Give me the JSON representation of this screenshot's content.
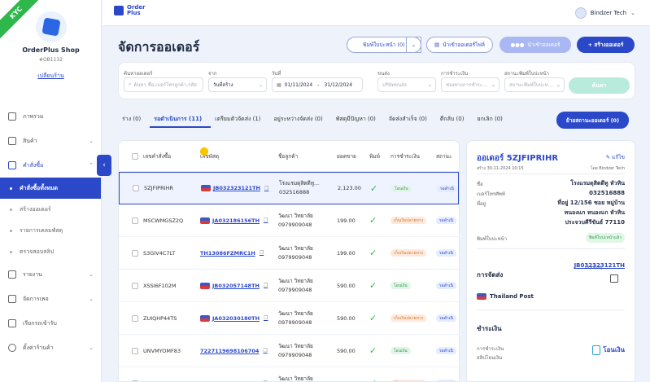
{
  "sidebar": {
    "kyc": "KYC",
    "shop_name": "OrderPlus Shop",
    "shop_id": "#OB1132",
    "change_shop": "เปลี่ยนร้าน",
    "items": [
      {
        "label": "ภาพรวม",
        "icon": "chart-icon"
      },
      {
        "label": "สินค้า",
        "icon": "box-icon"
      },
      {
        "label": "คำสั่งซื้อ",
        "icon": "cart-icon"
      },
      {
        "label": "รายงาน",
        "icon": "report-icon"
      },
      {
        "label": "จัดการเพจ",
        "icon": "chat-icon"
      },
      {
        "label": "เรียกรถเข้ารับ",
        "icon": "truck-icon"
      },
      {
        "label": "ตั้งค่าร้านค้า",
        "icon": "gear-icon"
      }
    ],
    "orders_sub": [
      "คำสั่งซื้อทั้งหมด",
      "สร้างออเดอร์",
      "รายการเคลมพัสดุ",
      "ตรวจสอบสลิป"
    ]
  },
  "topbar": {
    "logo_line1": "Order",
    "logo_line2": "Plus",
    "user_name": "Bindzer Tech"
  },
  "page": {
    "title": "จัดการออเดอร์",
    "print_label": "พิมพ์ใบปะหน้า (0)",
    "import_file_label": "นำเข้าออเดอร์ไฟล์",
    "import_order_label": "นำเข้าออเดอร์",
    "create_label": "+ สร้างออเดอร์"
  },
  "filters": {
    "search_label": "ค้นหาออเดอร์",
    "search_placeholder": "ค้นหา ชื่อ,เบอร์โทรลูกค้า,รหัส",
    "from_label": "จาก",
    "from_value": "วันที่สร้าง",
    "date_label": "วันที่",
    "date_start": "01/11/2024",
    "date_sep": "-",
    "date_end": "31/12/2024",
    "carrier_label": "ขนส่ง",
    "carrier_placeholder": "บริษัทขนส่ง",
    "payment_label": "การชำระเงิน",
    "payment_placeholder": "ช่องทางการชำระ...",
    "print_status_label": "สถานะพิมพ์ใบปะหน้า",
    "print_status_placeholder": "สถานะพิมพ์ใบปะห...",
    "search_button": "ค้นหา"
  },
  "tabs": [
    "ร่าง (0)",
    "รอดำเนินการ (11)",
    "เตรียมตัวจัดส่ง (1)",
    "อยู่ระหว่างจัดส่ง (0)",
    "พัสดุมีปัญหา (0)",
    "จัดส่งสำเร็จ (0)",
    "ตีกลับ (0)",
    "ยกเลิก (0)"
  ],
  "bulk_button": "ย้ายสถานะออเดอร์ (0)",
  "table": {
    "headers": [
      "เลขคำสั่งซื้อ",
      "เลขพัสดุ",
      "ชื่อลูกค้า",
      "ยอดขาย",
      "พิมพ์",
      "การชำระเงิน",
      "สถานะ"
    ],
    "rows": [
      {
        "order": "5ZJFIPRIHR",
        "carrier": "tp",
        "tracking": "JB032323121TH",
        "name": "โรงแรมดุสิตดีทู...",
        "phone": "032516888",
        "amount": "2,123.00",
        "pay": "โอนเงิน",
        "pay_type": "g",
        "status": "รอดำเนิ"
      },
      {
        "order": "MSCWMGSZ2Q",
        "carrier": "tp",
        "tracking": "JA032186156TH",
        "name": "วัฒนา วิทยาลัย",
        "phone": "0979909048",
        "amount": "199.00",
        "pay": "เก็บเงินปลายทาง",
        "pay_type": "o",
        "status": "รอดำเนิ"
      },
      {
        "order": "S3GIV4C7LT",
        "carrier": "fl",
        "tracking": "TH13086FZMRC1H",
        "name": "วัฒนา วิทยาลัย",
        "phone": "0979909048",
        "amount": "199.00",
        "pay": "เก็บเงินปลายทาง",
        "pay_type": "o",
        "status": "รอดำเนิ"
      },
      {
        "order": "XSSI6F102M",
        "carrier": "tp",
        "tracking": "JB032057148TH",
        "name": "วัฒนา วิทยาลัย",
        "phone": "0979909048",
        "amount": "590.00",
        "pay": "โอนเงิน",
        "pay_type": "g",
        "status": "รอดำเนิ"
      },
      {
        "order": "ZUIQHP44TS",
        "carrier": "tp",
        "tracking": "JA032030180TH",
        "name": "วัฒนา วิทยาลัย",
        "phone": "0979909048",
        "amount": "590.00",
        "pay": "เก็บเงินปลายทาง",
        "pay_type": "o",
        "status": "รอดำเนิ"
      },
      {
        "order": "UNVMYOMF83",
        "carrier": "fl",
        "tracking": "7227119698106704",
        "name": "วัฒนา วิทยาลัย",
        "phone": "0979909048",
        "amount": "590.00",
        "pay": "โอนเงิน",
        "pay_type": "g",
        "status": "รอดำเนิ"
      },
      {
        "order": "VAMHKWSWXB",
        "carrier": "fl",
        "tracking": "7227119698113504",
        "name": "วัฒนา วิทยาลัย",
        "phone": "0979909048",
        "amount": "590.00",
        "pay": "เก็บเงินปลายทาง",
        "pay_type": "o",
        "status": "รอดำเนิ"
      }
    ]
  },
  "detail": {
    "title": "ออเดอร์ 5ZJFIPRIHR",
    "edit": "แก้ไข",
    "created": "สร้าง 30-11-2024 10:15",
    "by": "โดย Bindzer Tech",
    "name_label": "ชื่อ",
    "name_value": "โรงแรมดุสิตดีทู หัวหิน",
    "phone_label": "เบอร์โทรศัพท์",
    "phone_value": "032516888",
    "address_label": "ที่อยู่",
    "address_l1": "ที่อยู่ 12/156 ซอย หมู่บ้าน",
    "address_l2": "หนองแก หนองแก หัวหิน",
    "address_l3": "ประจวบคีรีขันธ์ 77110",
    "print_label": "พิมพ์ใบปะหน้า",
    "print_badge": "พิมพ์ใบปะหน้าแล้ว",
    "shipping_title": "การจัดส่ง",
    "tracking_label": "เลขพัสดุ",
    "tracking_value": "JB032323121TH",
    "carrier_name": "Thailand Post",
    "payment_title": "ชำระเงิน",
    "method_label": "การชำระเงิน",
    "slip_label": "สลิปโอนเงิน",
    "method_value": "โอนเงิน"
  }
}
